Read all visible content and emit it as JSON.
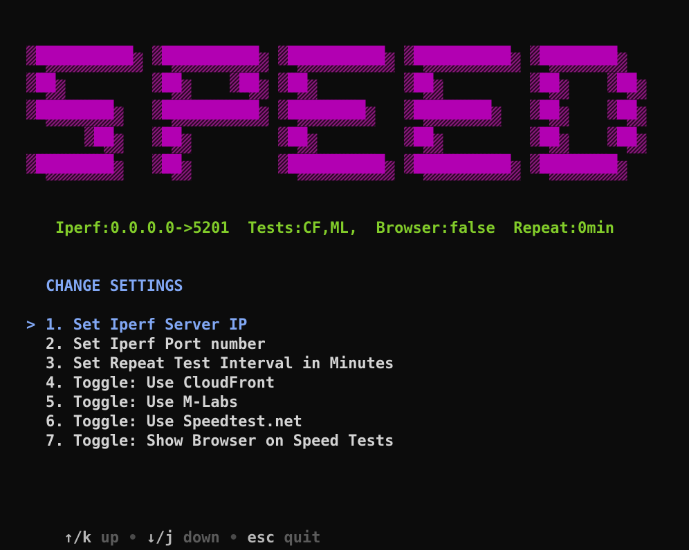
{
  "banner": {
    "text": "SPEED",
    "color": "#b200b2",
    "shadow_color": "#6e0b63"
  },
  "status": {
    "text": "Iperf:0.0.0.0->5201  Tests:CF,ML,  Browser:false  Repeat:0min",
    "color": "#82cc2a"
  },
  "section": {
    "title": "CHANGE SETTINGS",
    "color": "#82a8f5"
  },
  "menu": {
    "cursor": ">",
    "selected_index": 0,
    "items": [
      {
        "label": "1. Set Iperf Server IP"
      },
      {
        "label": "2. Set Iperf Port number"
      },
      {
        "label": "3. Set Repeat Test Interval in Minutes"
      },
      {
        "label": "4. Toggle: Use CloudFront"
      },
      {
        "label": "5. Toggle: Use M-Labs"
      },
      {
        "label": "6. Toggle: Use Speedtest.net"
      },
      {
        "label": "7. Toggle: Show Browser on Speed Tests"
      }
    ]
  },
  "help": {
    "separator": "•",
    "items": [
      {
        "key": "↑/k",
        "desc": "up"
      },
      {
        "key": "↓/j",
        "desc": "down"
      },
      {
        "key": "esc",
        "desc": "quit"
      }
    ]
  }
}
